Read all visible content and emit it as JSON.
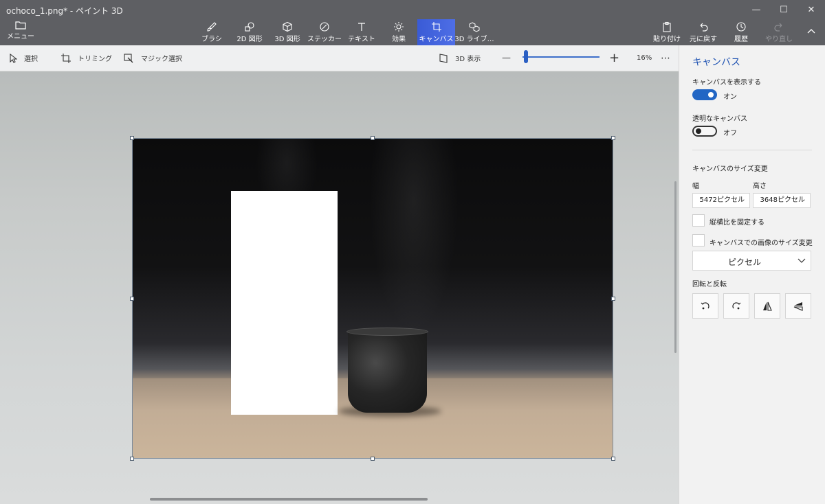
{
  "window": {
    "title": "ochoco_1.png* - ペイント 3D",
    "minimize_label": "—",
    "maximize_label": "☐",
    "close_label": "✕"
  },
  "ribbon": {
    "menu_label": "メニュー",
    "tools": [
      {
        "label": "ブラシ",
        "icon": "brush-icon"
      },
      {
        "label": "2D 図形",
        "icon": "2d-shapes-icon"
      },
      {
        "label": "3D 図形",
        "icon": "3d-shapes-icon"
      },
      {
        "label": "ステッカー",
        "icon": "sticker-icon"
      },
      {
        "label": "テキスト",
        "icon": "text-icon"
      },
      {
        "label": "効果",
        "icon": "effects-icon"
      },
      {
        "label": "キャンバス",
        "icon": "canvas-icon",
        "active": true
      },
      {
        "label": "3D ライブ…",
        "icon": "3d-library-icon"
      }
    ],
    "right_tools": [
      {
        "label": "貼り付け",
        "icon": "paste-icon"
      },
      {
        "label": "元に戻す",
        "icon": "undo-icon"
      },
      {
        "label": "履歴",
        "icon": "history-icon"
      },
      {
        "label": "やり直し",
        "icon": "redo-icon",
        "disabled": true
      }
    ]
  },
  "toolbar2": {
    "select_label": "選択",
    "crop_label": "トリミング",
    "magic_select_label": "マジック選択",
    "view3d_label": "3D 表示",
    "zoom_minus": "—",
    "zoom_plus": "+",
    "zoom_value": "16%",
    "more_label": "⋯"
  },
  "panel": {
    "title": "キャンバス",
    "show_canvas_label": "キャンバスを表示する",
    "show_canvas_state": "オン",
    "transparent_label": "透明なキャンバス",
    "transparent_state": "オフ",
    "resize_label": "キャンバスのサイズ変更",
    "width_label": "幅",
    "height_label": "高さ",
    "width_value": "5472ピクセル",
    "height_value": "3648ピクセル",
    "lock_aspect_label": "縦横比を固定する",
    "resize_image_label": "キャンバスでの画像のサイズ変更",
    "unit_selected": "ピクセル",
    "rotate_flip_label": "回転と反転"
  },
  "colors": {
    "titlebar": "#5e5f63",
    "accent": "#2266c4",
    "active_tab": "#4264db"
  }
}
